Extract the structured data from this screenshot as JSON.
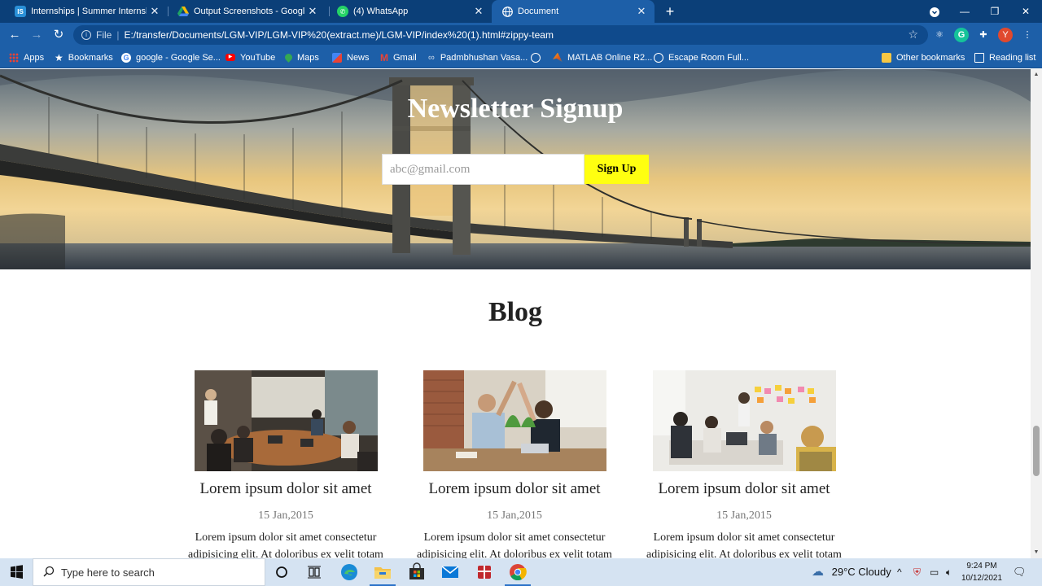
{
  "browser": {
    "tabs": [
      {
        "title": "Internships | Summer Internship",
        "favicon": "internshala-icon",
        "color": "#2a90d8",
        "active": false
      },
      {
        "title": "Output Screenshots - Google Dr",
        "favicon": "google-drive-icon",
        "color": "#fbbc04",
        "active": false
      },
      {
        "title": "(4) WhatsApp",
        "favicon": "whatsapp-icon",
        "color": "#25d366",
        "active": false
      },
      {
        "title": "Document",
        "favicon": "globe-icon",
        "color": "#ffffff",
        "active": true
      }
    ],
    "address": {
      "scheme_label": "File",
      "url": "E:/transfer/Documents/LGM-VIP/LGM-VIP%20(extract.me)/LGM-VIP/index%20(1).html#zippy-team"
    },
    "profile_initial": "Y",
    "bookmarks": [
      {
        "label": "Apps",
        "icon": "apps-grid-icon"
      },
      {
        "label": "Bookmarks",
        "icon": "star-icon"
      },
      {
        "label": "google - Google Se...",
        "icon": "google-icon"
      },
      {
        "label": "YouTube",
        "icon": "youtube-icon"
      },
      {
        "label": "Maps",
        "icon": "maps-icon"
      },
      {
        "label": "News",
        "icon": "news-icon"
      },
      {
        "label": "Gmail",
        "icon": "gmail-icon"
      },
      {
        "label": "Padmbhushan Vasa...",
        "icon": "link-icon"
      },
      {
        "label": "",
        "icon": "globe-icon"
      },
      {
        "label": "MATLAB Online R2...",
        "icon": "matlab-icon"
      },
      {
        "label": "Escape Room Full...",
        "icon": "globe-icon"
      }
    ],
    "other_bookmarks": "Other bookmarks",
    "reading_list": "Reading list"
  },
  "page": {
    "newsletter": {
      "title": "Newsletter Signup",
      "email_placeholder": "abc@gmail.com",
      "button_label": "Sign Up"
    },
    "blog": {
      "title": "Blog",
      "posts": [
        {
          "title": "Lorem ipsum dolor sit amet",
          "date": "15 Jan,2015",
          "excerpt": "Lorem ipsum dolor sit amet consectetur adipisicing elit. At doloribus ex velit totam"
        },
        {
          "title": "Lorem ipsum dolor sit amet",
          "date": "15 Jan,2015",
          "excerpt": "Lorem ipsum dolor sit amet consectetur adipisicing elit. At doloribus ex velit totam"
        },
        {
          "title": "Lorem ipsum dolor sit amet",
          "date": "15 Jan,2015",
          "excerpt": "Lorem ipsum dolor sit amet consectetur adipisicing elit. At doloribus ex velit totam"
        }
      ]
    }
  },
  "taskbar": {
    "search_placeholder": "Type here to search",
    "weather": "29°C  Cloudy",
    "time": "9:24 PM",
    "date": "10/12/2021"
  },
  "colors": {
    "tabstrip": "#0b3f78",
    "toolbar": "#1d5fa8",
    "signup_button": "#ffff10"
  }
}
